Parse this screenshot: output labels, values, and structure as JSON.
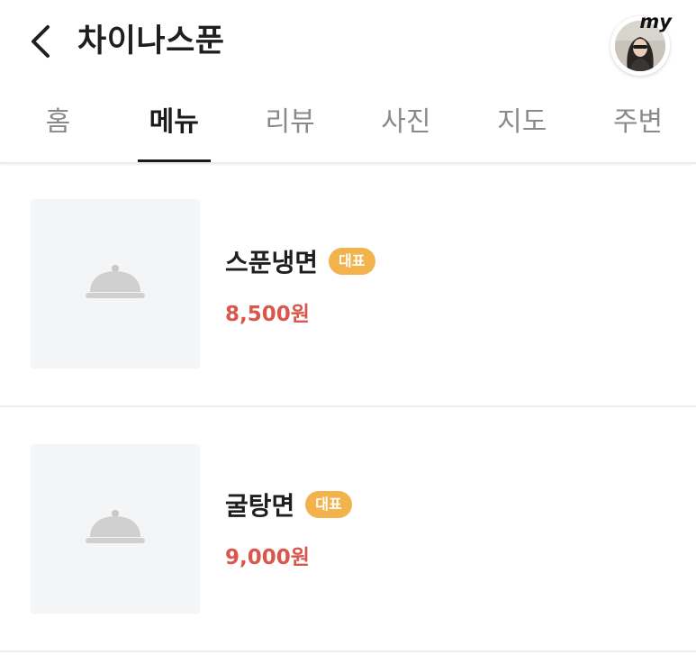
{
  "header": {
    "title": "차이나스푼",
    "back_icon": "chevron-left-icon",
    "avatar_badge": "my"
  },
  "tabs": [
    {
      "label": "홈",
      "active": false
    },
    {
      "label": "메뉴",
      "active": true
    },
    {
      "label": "리뷰",
      "active": false
    },
    {
      "label": "사진",
      "active": false
    },
    {
      "label": "지도",
      "active": false
    },
    {
      "label": "주변",
      "active": false
    }
  ],
  "menu": {
    "items": [
      {
        "name": "스푼냉면",
        "badge": "대표",
        "price": "8,500원",
        "image_icon": "food-cloche-icon"
      },
      {
        "name": "굴탕면",
        "badge": "대표",
        "price": "9,000원",
        "image_icon": "food-cloche-icon"
      }
    ]
  },
  "colors": {
    "price": "#d9574c",
    "badge": "#f2b24c",
    "active_tab": "#1a1a1a",
    "inactive_tab": "#8a8a8a",
    "thumb_bg": "#f4f5f6"
  }
}
